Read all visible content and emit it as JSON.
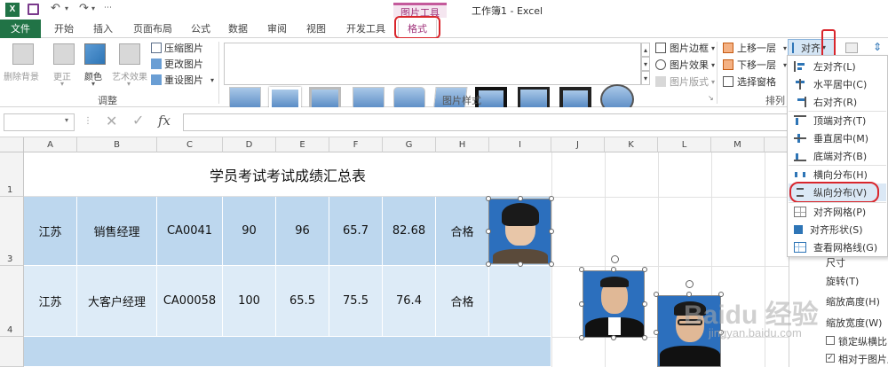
{
  "titlebar": {
    "picture_tools": "图片工具",
    "title": "工作簿1 - Excel"
  },
  "tabs": {
    "file": "文件",
    "home": "开始",
    "insert": "插入",
    "page_layout": "页面布局",
    "formulas": "公式",
    "data": "数据",
    "review": "审阅",
    "view": "视图",
    "developer": "开发工具",
    "format": "格式"
  },
  "ribbon": {
    "remove_bg": "删除背景",
    "corrections": "更正",
    "color": "颜色",
    "artistic": "艺术效果",
    "compress": "压缩图片",
    "change": "更改图片",
    "reset": "重设图片",
    "adjust_group": "调整",
    "styles_group": "图片样式",
    "border": "图片边框",
    "effects": "图片效果",
    "layout": "图片版式",
    "bring_forward": "上移一层",
    "send_backward": "下移一层",
    "selection_pane": "选择窗格",
    "arrange_group": "排列",
    "align": "对齐"
  },
  "formula_bar": {
    "fx": "fx"
  },
  "columns": [
    "A",
    "B",
    "C",
    "D",
    "E",
    "F",
    "G",
    "H",
    "I",
    "J",
    "K",
    "L",
    "M"
  ],
  "rows": {
    "r1": "1",
    "r3": "3",
    "r4": "4"
  },
  "table": {
    "title": "学员考试考试成绩汇总表",
    "row1": [
      "江苏",
      "销售经理",
      "CA0041",
      "90",
      "96",
      "65.7",
      "82.68",
      "合格"
    ],
    "row2": [
      "江苏",
      "大客户经理",
      "CA00058",
      "100",
      "65.5",
      "75.5",
      "76.4",
      "合格"
    ]
  },
  "align_menu": {
    "items": [
      {
        "label": "左对齐(L)"
      },
      {
        "label": "水平居中(C)"
      },
      {
        "label": "右对齐(R)"
      },
      {
        "label": "顶端对齐(T)"
      },
      {
        "label": "垂直居中(M)"
      },
      {
        "label": "底端对齐(B)"
      },
      {
        "label": "横向分布(H)"
      },
      {
        "label": "纵向分布(V)"
      },
      {
        "label": "对齐网格(P)"
      },
      {
        "label": "对齐形状(S)"
      },
      {
        "label": "查看网格线(G)"
      }
    ]
  },
  "side_pane": {
    "rotate": "旋转(T)",
    "scale_height": "缩放高度(H)",
    "scale_width": "缩放宽度(W)",
    "lock_ratio": "锁定纵横比(A",
    "relative": "相对于图片原",
    "size_label": "尺寸"
  },
  "watermark": {
    "brand": "Baidu 经验",
    "url": "jingyan.baidu.com"
  },
  "colors": {
    "excel_green": "#217346",
    "accent_red": "#d9262c",
    "cell_blue_dark": "#bdd7ee",
    "cell_blue_light": "#ddebf7",
    "picture_tools_pink": "#c45a9b"
  }
}
